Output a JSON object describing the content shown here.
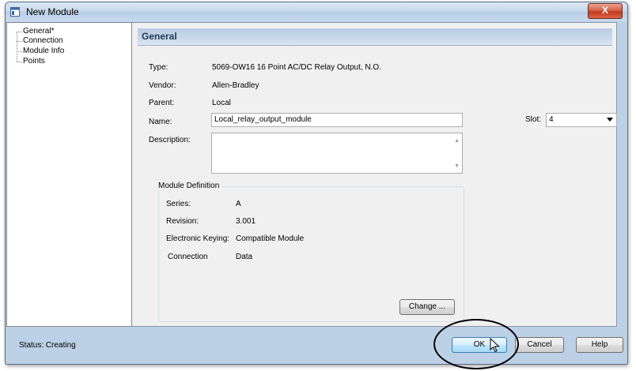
{
  "window": {
    "title": "New Module",
    "close_label": "X"
  },
  "tree": {
    "items": [
      "General*",
      "Connection",
      "Module Info",
      "Points"
    ]
  },
  "general": {
    "header": "General",
    "type_label": "Type:",
    "type_value": "5069-OW16 16 Point AC/DC Relay Output, N.O.",
    "vendor_label": "Vendor:",
    "vendor_value": "Allen-Bradley",
    "parent_label": "Parent:",
    "parent_value": "Local",
    "name_label": "Name:",
    "name_value": "Local_relay_output_module",
    "description_label": "Description:",
    "description_value": "",
    "slot_label": "Slot:",
    "slot_value": "4"
  },
  "module_definition": {
    "title": "Module Definition",
    "series_label": "Series:",
    "series_value": "A",
    "revision_label": "Revision:",
    "revision_value": "3.001",
    "keying_label": "Electronic Keying:",
    "keying_value": "Compatible Module",
    "connection_label": "Connection",
    "connection_value": "Data",
    "change_button": "Change ..."
  },
  "footer": {
    "status": "Status: Creating",
    "ok_button": "OK",
    "cancel_button": "Cancel",
    "help_button": "Help"
  },
  "icons": {
    "title_icon": "window-icon",
    "cursor": "mouse-pointer-icon"
  },
  "colors": {
    "header_text": "#1e395b",
    "close_button": "#c2391c",
    "ok_border": "#3c7fb1"
  }
}
